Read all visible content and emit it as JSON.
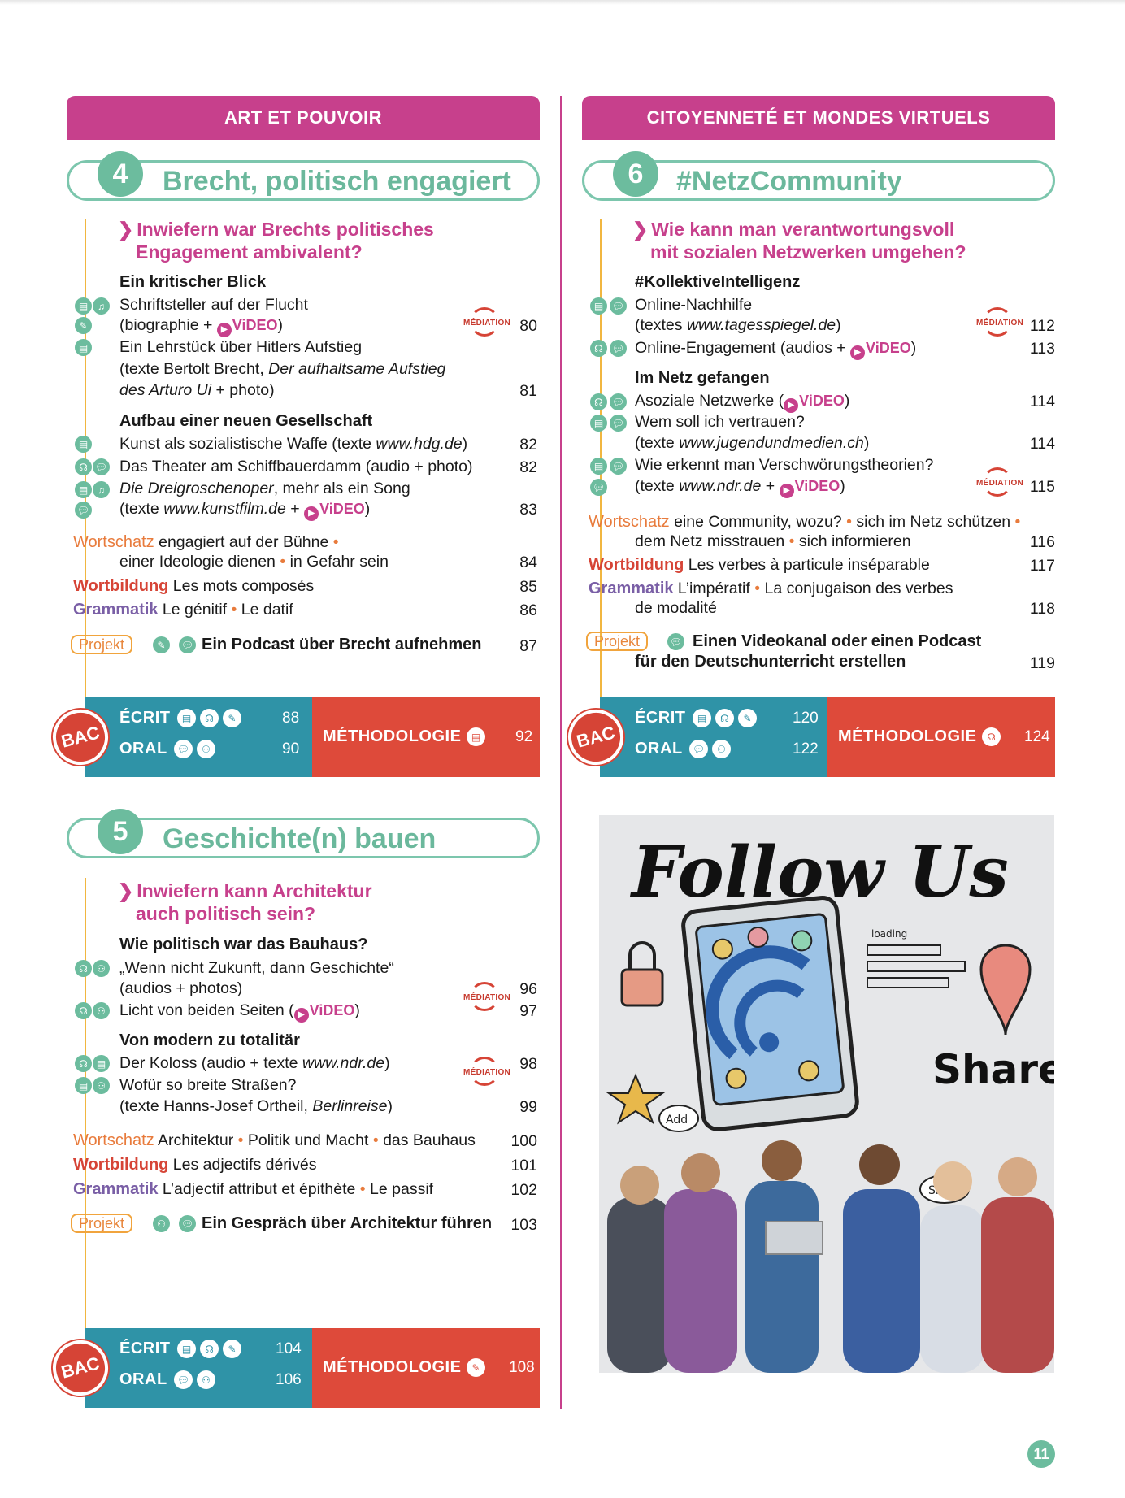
{
  "page_number": "11",
  "left": {
    "theme": "ART ET POUVOIR",
    "ch4": {
      "number": "4",
      "title": "Brecht, politisch engagiert",
      "question": [
        "Inwiefern war Brechts politisches",
        "Engagement ambivalent?"
      ],
      "s1_title": "Ein kritischer Blick",
      "s1_l1": "Schriftsteller auf der Flucht",
      "s1_l2": "(biographie +",
      "s1_l3": "Ein Lehrstück über Hitlers Aufstieg",
      "s1_l4a": "(texte Bertolt Brecht,",
      "s1_l4b": "Der aufhaltsame Aufstieg",
      "s1_l5a": "des Arturo Ui",
      "s1_l5b": "+ photo)",
      "s1_p1": "80",
      "s1_p2": "81",
      "s2_title": "Aufbau einer neuen Gesellschaft",
      "s2_l1a": "Kunst als sozialistische Waffe",
      "s2_l1b": "(texte",
      "s2_l1c": "www.hdg.de",
      "s2_l1d": ")",
      "s2_l2a": "Das Theater am Schiffbauerdamm",
      "s2_l2b": "(audio + photo)",
      "s2_l3a": "Die Dreigroschenoper",
      "s2_l3b": ", mehr als ein Song",
      "s2_l4a": "(texte",
      "s2_l4b": "www.kunstfilm.de",
      "s2_l4c": "+",
      "s2_p1": "82",
      "s2_p2": "82",
      "s2_p3": "83",
      "wortschatz_label": "Wortschatz",
      "wortschatz_1": "engagiert auf der Bühne",
      "wortschatz_2": "einer Ideologie dienen",
      "wortschatz_3": "in Gefahr sein",
      "wortschatz_page": "84",
      "wortbildung_label": "Wortbildung",
      "wortbildung_text": "Les mots composés",
      "wortbildung_page": "85",
      "grammatik_label": "Grammatik",
      "grammatik_1": "Le génitif",
      "grammatik_2": "Le datif",
      "grammatik_page": "86",
      "projekt_label": "Projekt",
      "projekt_text": "Ein Podcast über Brecht aufnehmen",
      "projekt_page": "87",
      "bac": {
        "badge": "BAC",
        "ecrit": "ÉCRIT",
        "ecrit_page": "88",
        "oral": "ORAL",
        "oral_page": "90",
        "methodologie": "MÉTHODOLOGIE",
        "methodologie_page": "92"
      }
    },
    "ch5": {
      "number": "5",
      "title": "Geschichte(n) bauen",
      "question": [
        "Inwiefern kann Architektur",
        "auch politisch sein?"
      ],
      "s1_title": "Wie politisch war das Bauhaus?",
      "s1_l1": "„Wenn nicht Zukunft, dann Geschichte“",
      "s1_l2": "(audios + photos)",
      "s1_l3a": "Licht von beiden Seiten (",
      "s1_l3b": ")",
      "s1_p1": "96",
      "s1_p2": "97",
      "s2_title": "Von modern zu totalitär",
      "s2_l1a": "Der Koloss (audio + texte",
      "s2_l1b": "www.ndr.de",
      "s2_l1c": ")",
      "s2_l2": "Wofür so breite Straßen?",
      "s2_l3a": "(texte Hanns-Josef Ortheil,",
      "s2_l3b": "Berlinreise",
      "s2_l3c": ")",
      "s2_p1": "98",
      "s2_p2": "99",
      "wortschatz_label": "Wortschatz",
      "wortschatz_1": "Architektur",
      "wortschatz_2": "Politik und Macht",
      "wortschatz_3": "das Bauhaus",
      "wortschatz_page": "100",
      "wortbildung_label": "Wortbildung",
      "wortbildung_text": "Les adjectifs dérivés",
      "wortbildung_page": "101",
      "grammatik_label": "Grammatik",
      "grammatik_1": "L’adjectif attribut et épithète",
      "grammatik_2": "Le passif",
      "grammatik_page": "102",
      "projekt_label": "Projekt",
      "projekt_text": "Ein Gespräch über Architektur führen",
      "projekt_page": "103",
      "bac": {
        "badge": "BAC",
        "ecrit": "ÉCRIT",
        "ecrit_page": "104",
        "oral": "ORAL",
        "oral_page": "106",
        "methodologie": "MÉTHODOLOGIE",
        "methodologie_page": "108"
      }
    }
  },
  "right": {
    "theme": "CITOYENNETÉ ET MONDES VIRTUELS",
    "ch6": {
      "number": "6",
      "title": "#NetzCommunity",
      "question": [
        "Wie kann man verantwortungsvoll",
        "mit sozialen Netzwerken umgehen?"
      ],
      "s1_title": "#KollektiveIntelligenz",
      "s1_l1": "Online-Nachhilfe",
      "s1_l2a": "(textes",
      "s1_l2b": "www.tagesspiegel.de",
      "s1_l2c": ")",
      "s1_l3a": "Online-Engagement (audios +",
      "s1_l3b": ")",
      "s1_p1": "112",
      "s1_p2": "113",
      "s2_title": "Im Netz gefangen",
      "s2_l1a": "Asoziale Netzwerke (",
      "s2_l1b": ")",
      "s2_l2": "Wem soll ich vertrauen?",
      "s2_l3a": "(texte",
      "s2_l3b": "www.jugendundmedien.ch",
      "s2_l3c": ")",
      "s2_l4": "Wie erkennt man Verschwörungstheorien?",
      "s2_l5a": "(texte",
      "s2_l5b": "www.ndr.de",
      "s2_l5c": "+",
      "s2_l5d": ")",
      "s2_p1": "114",
      "s2_p2": "114",
      "s2_p3": "115",
      "wortschatz_label": "Wortschatz",
      "wortschatz_1": "eine Community, wozu?",
      "wortschatz_2": "sich im Netz schützen",
      "wortschatz_3": "dem Netz misstrauen",
      "wortschatz_4": "sich informieren",
      "wortschatz_page": "116",
      "wortbildung_label": "Wortbildung",
      "wortbildung_text": "Les verbes à particule inséparable",
      "wortbildung_page": "117",
      "grammatik_label": "Grammatik",
      "grammatik_1": "L’impératif",
      "grammatik_2": "La conjugaison des verbes",
      "grammatik_3": "de modalité",
      "grammatik_page": "118",
      "projekt_label": "Projekt",
      "projekt_text_1": "Einen Videokanal oder einen Podcast",
      "projekt_text_2": "für den Deutschunterricht erstellen",
      "projekt_page": "119",
      "bac": {
        "badge": "BAC",
        "ecrit": "ÉCRIT",
        "ecrit_page": "120",
        "oral": "ORAL",
        "oral_page": "122",
        "methodologie": "MÉTHODOLOGIE",
        "methodologie_page": "124"
      }
    },
    "photo": {
      "headline": "Follow Us",
      "share_big": "Share",
      "loading": "loading",
      "add": "Add",
      "share_small": "Share"
    }
  },
  "labels": {
    "video": "ViDEO",
    "mediation": "MÉDIATION"
  },
  "colors": {
    "magenta": "#c7408c",
    "teal": "#2f93a7",
    "green": "#6cbc9e",
    "red": "#de4a3a",
    "orange": "#e87b3c",
    "purple": "#7a5fa6",
    "yellow_line": "#f1b640"
  }
}
